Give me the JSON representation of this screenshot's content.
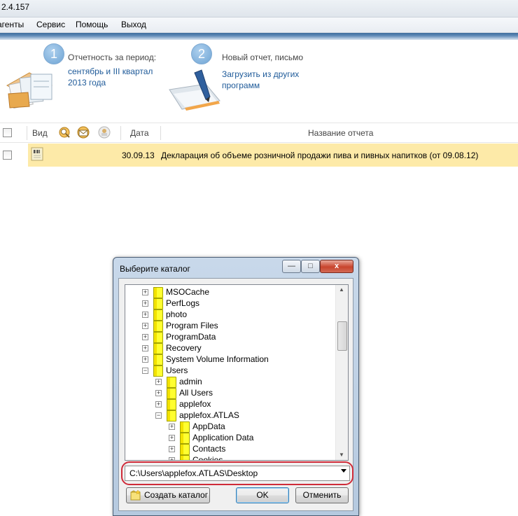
{
  "window": {
    "title": "2.4.157"
  },
  "menu": [
    "агенты",
    "Сервис",
    "Помощь",
    "Выход"
  ],
  "steps": [
    {
      "number": "1",
      "label": "Отчетность за период:",
      "link_lines": [
        "сентябрь и III квартал",
        "2013 года"
      ]
    },
    {
      "number": "2",
      "label": "Новый отчет, письмо",
      "link_lines": [
        "Загрузить из других",
        "программ"
      ]
    }
  ],
  "table": {
    "columns": {
      "view": "Вид",
      "date": "Дата",
      "name": "Название отчета"
    },
    "rows": [
      {
        "date": "30.09.13",
        "name": "Декларация об объеме розничной продажи пива и пивных напитков (от 09.08.12)"
      }
    ]
  },
  "dialog": {
    "title": "Выберите каталог",
    "controls": {
      "minimize": "—",
      "maximize": "□",
      "close": "x"
    },
    "tree": [
      {
        "label": "MSOCache",
        "level": 0,
        "expander": "+"
      },
      {
        "label": "PerfLogs",
        "level": 0,
        "expander": "+"
      },
      {
        "label": "photo",
        "level": 0,
        "expander": "+"
      },
      {
        "label": "Program Files",
        "level": 0,
        "expander": "+"
      },
      {
        "label": "ProgramData",
        "level": 0,
        "expander": "+"
      },
      {
        "label": "Recovery",
        "level": 0,
        "expander": "+"
      },
      {
        "label": "System Volume Information",
        "level": 0,
        "expander": "+"
      },
      {
        "label": "Users",
        "level": 0,
        "expander": "−"
      },
      {
        "label": "admin",
        "level": 1,
        "expander": "+"
      },
      {
        "label": "All Users",
        "level": 1,
        "expander": "+"
      },
      {
        "label": "applefox",
        "level": 1,
        "expander": "+"
      },
      {
        "label": "applefox.ATLAS",
        "level": 1,
        "expander": "−"
      },
      {
        "label": "AppData",
        "level": 2,
        "expander": "+"
      },
      {
        "label": "Application Data",
        "level": 2,
        "expander": "+"
      },
      {
        "label": "Contacts",
        "level": 2,
        "expander": "+"
      },
      {
        "label": "Cookies",
        "level": 2,
        "expander": "+"
      }
    ],
    "path": "C:\\Users\\applefox.ATLAS\\Desktop",
    "buttons": {
      "create": "Создать каталог",
      "ok": "OK",
      "cancel": "Отменить"
    }
  },
  "colors": {
    "row_highlight": "#fdeaa8",
    "link": "#1e5a99",
    "annotation": "#cf2b39"
  }
}
